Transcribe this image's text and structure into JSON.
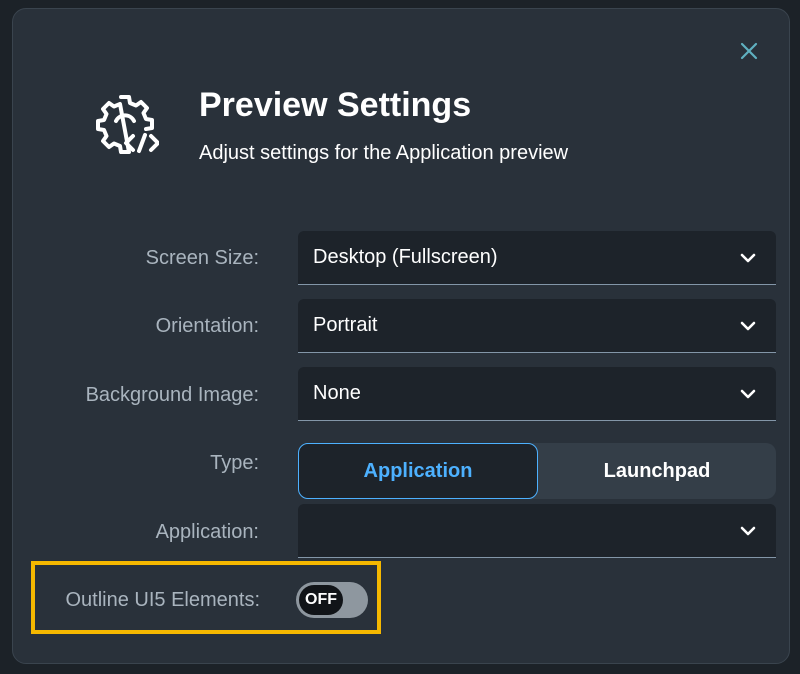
{
  "dialog": {
    "title": "Preview Settings",
    "subtitle": "Adjust settings for the Application preview",
    "icon": "gear-code-icon",
    "close_icon": "close-icon"
  },
  "form": {
    "screen_size": {
      "label": "Screen Size:",
      "value": "Desktop (Fullscreen)"
    },
    "orientation": {
      "label": "Orientation:",
      "value": "Portrait"
    },
    "background_image": {
      "label": "Background Image:",
      "value": "None"
    },
    "type": {
      "label": "Type:",
      "options": [
        "Application",
        "Launchpad"
      ],
      "selected": "Application"
    },
    "application": {
      "label": "Application:",
      "value": ""
    },
    "outline": {
      "label": "Outline UI5 Elements:",
      "state": "OFF"
    }
  },
  "colors": {
    "accent": "#4db1ff",
    "highlight": "#f5b800",
    "dialog_bg": "#29313a",
    "field_bg": "#1d232a"
  }
}
